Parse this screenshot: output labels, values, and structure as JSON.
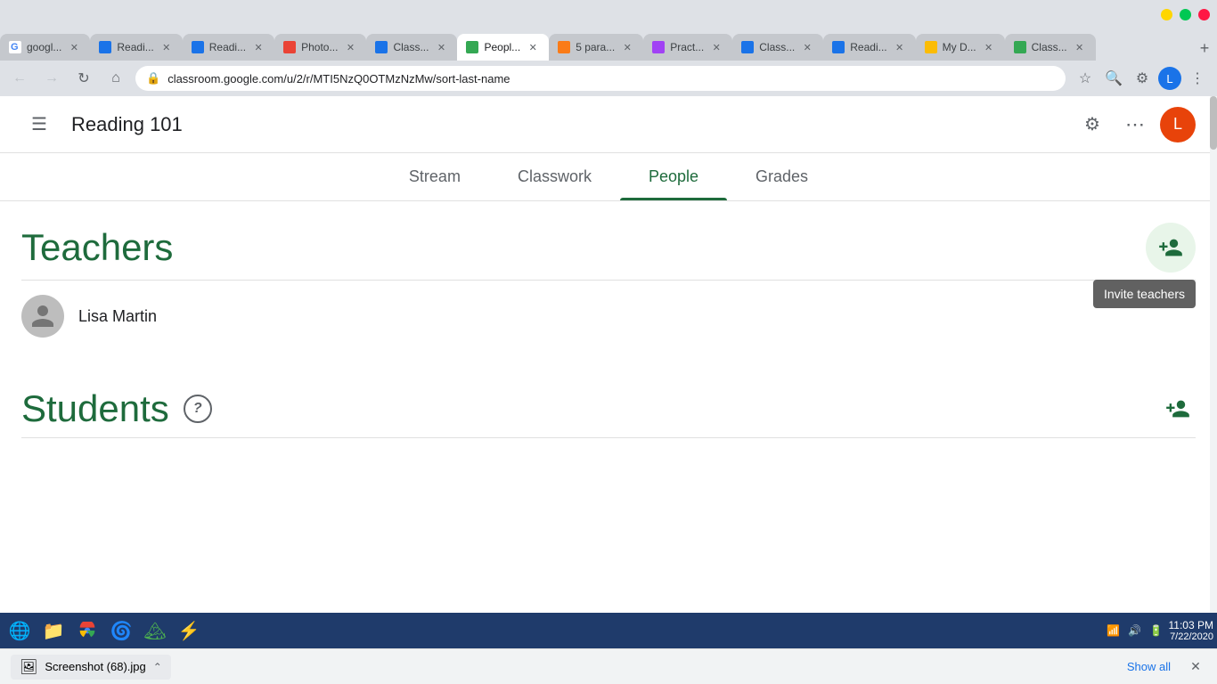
{
  "browser": {
    "tabs": [
      {
        "id": "tab1",
        "favicon_color": "#4285f4",
        "favicon_letter": "G",
        "label": "googl...",
        "active": false,
        "favicon_type": "google"
      },
      {
        "id": "tab2",
        "favicon_color": "#1a73e8",
        "label": "Readi...",
        "active": false,
        "favicon_type": "classroom"
      },
      {
        "id": "tab3",
        "favicon_color": "#1a73e8",
        "label": "Readi...",
        "active": false,
        "favicon_type": "classroom"
      },
      {
        "id": "tab4",
        "favicon_color": "#ea4335",
        "label": "Photo...",
        "active": false,
        "favicon_type": "photo"
      },
      {
        "id": "tab5",
        "favicon_color": "#1a73e8",
        "label": "Class...",
        "active": false,
        "favicon_type": "classroom"
      },
      {
        "id": "tab6",
        "favicon_color": "#34a853",
        "label": "Peopl...",
        "active": true,
        "favicon_type": "classroom_green"
      },
      {
        "id": "tab7",
        "favicon_color": "#fa7b17",
        "label": "5 para...",
        "active": false,
        "favicon_type": "classroom_orange"
      },
      {
        "id": "tab8",
        "favicon_color": "#a142f4",
        "label": "Pract...",
        "active": false,
        "favicon_type": "classroom_purple"
      },
      {
        "id": "tab9",
        "favicon_color": "#1a73e8",
        "label": "Class...",
        "active": false,
        "favicon_type": "classroom"
      },
      {
        "id": "tab10",
        "favicon_color": "#1a73e8",
        "label": "Readi...",
        "active": false,
        "favicon_type": "classroom"
      },
      {
        "id": "tab11",
        "favicon_color": "#fbbc04",
        "label": "My D...",
        "active": false,
        "favicon_type": "drive"
      },
      {
        "id": "tab12",
        "favicon_color": "#34a853",
        "label": "Class...",
        "active": false,
        "favicon_type": "classroom_green"
      }
    ],
    "url": "classroom.google.com/u/2/r/MTI5NzQ0OTMzNzMw/sort-last-name",
    "window_controls": {
      "minimize": "–",
      "maximize": "❐",
      "close": "✕"
    }
  },
  "header": {
    "title": "Reading 101",
    "menu_label": "☰",
    "settings_label": "⚙",
    "apps_label": "⠿",
    "profile_letter": "L"
  },
  "nav": {
    "tabs": [
      {
        "id": "stream",
        "label": "Stream",
        "active": false
      },
      {
        "id": "classwork",
        "label": "Classwork",
        "active": false
      },
      {
        "id": "people",
        "label": "People",
        "active": true
      },
      {
        "id": "grades",
        "label": "Grades",
        "active": false
      }
    ]
  },
  "teachers_section": {
    "title": "Teachers",
    "invite_tooltip": "Invite teachers",
    "teacher": {
      "name": "Lisa Martin"
    }
  },
  "students_section": {
    "title": "Students"
  },
  "downloads_bar": {
    "file_name": "Screenshot (68).jpg",
    "show_all_label": "Show all",
    "close_label": "✕"
  },
  "taskbar": {
    "time": "11:03 PM",
    "date": "7/22/2020"
  }
}
